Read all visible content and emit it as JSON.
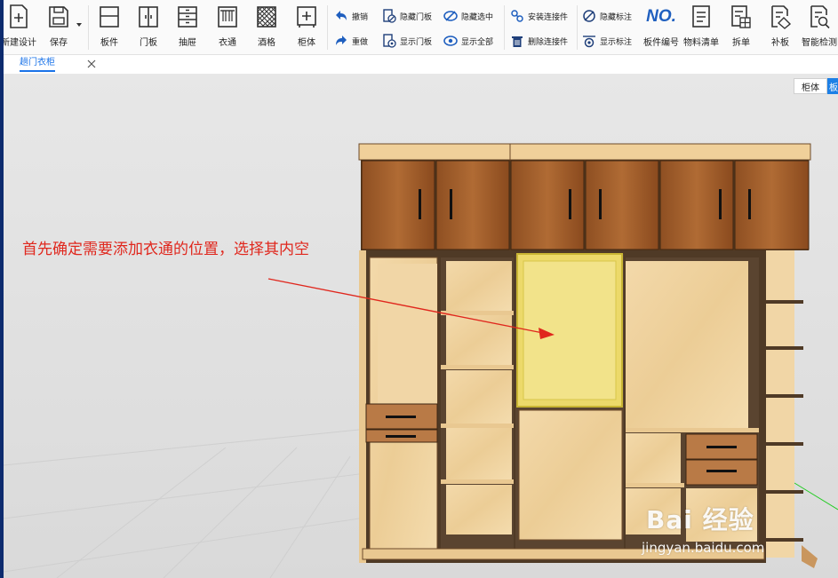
{
  "toolbar": {
    "new_design": "新建设计",
    "save": "保存",
    "board": "板件",
    "door": "门板",
    "drawer": "抽屉",
    "hanger": "衣通",
    "wine_rack": "酒格",
    "cabinet": "柜体",
    "undo": "撤销",
    "redo": "重做",
    "hide_door": "隐藏门板",
    "show_door": "显示门板",
    "hide_selected": "隐藏选中",
    "show_all": "显示全部",
    "install_connector": "安装连接件",
    "delete_connector": "删除连接件",
    "hide_annotation": "隐藏标注",
    "show_annotation": "显示标注",
    "no_badge": "NO.",
    "board_number": "板件编号",
    "material_list": "物料清单",
    "split_order": "拆单",
    "patch_board": "补板",
    "smart_check": "智能检测"
  },
  "tabs": {
    "document": "趟门衣柜"
  },
  "view_tabs": {
    "cabinet": "柜体",
    "board": "板"
  },
  "annotation": "首先确定需要添加衣通的位置，选择其内空",
  "watermark": {
    "logo": "Bai 经验",
    "url": "jingyan.baidu.com"
  },
  "colors": {
    "accent": "#1a73e8",
    "annotation": "#e0271d",
    "wood_light": "#f0d3a0",
    "wood_dark": "#9a5a2a",
    "highlight": "#f2e170"
  }
}
